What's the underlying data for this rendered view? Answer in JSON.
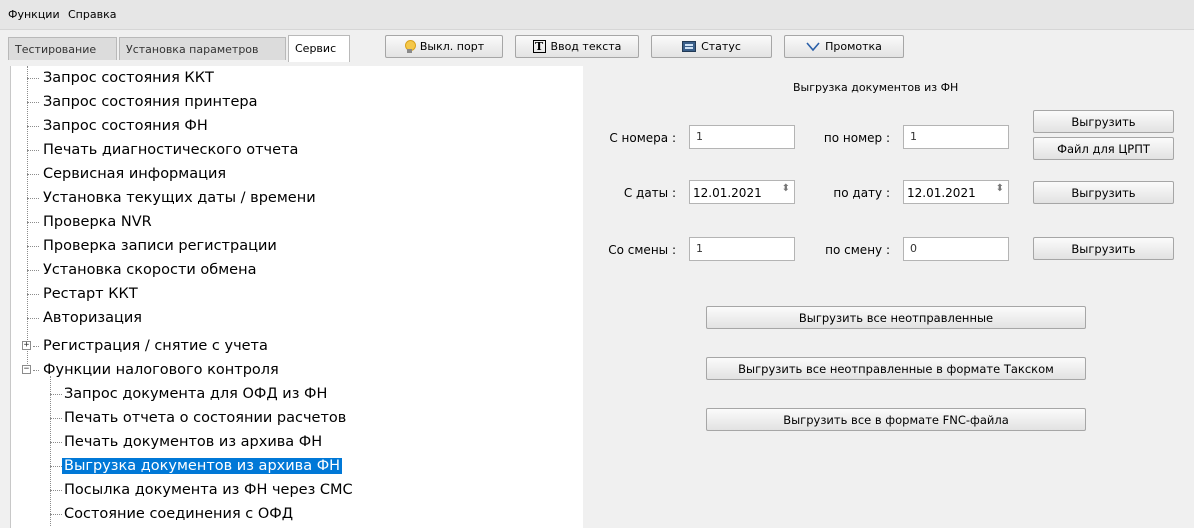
{
  "menu": {
    "items": [
      "Функции",
      "Справка"
    ]
  },
  "tabs": [
    {
      "label": "Тестирование"
    },
    {
      "label": "Установка параметров"
    },
    {
      "label": "Сервис",
      "active": true
    }
  ],
  "toolbar": {
    "port_off": "Выкл. порт",
    "text_input": "Ввод текста",
    "status": "Статус",
    "feed": "Промотка"
  },
  "tree": {
    "items": [
      "Запрос состояния ККТ",
      "Запрос состояния принтера",
      "Запрос состояния ФН",
      "Печать диагностического отчета",
      "Сервисная информация",
      "Установка текущих даты / времени",
      "Проверка NVR",
      "Проверка записи регистрации",
      "Установка скорости обмена",
      "Рестарт ККТ",
      "Авторизация",
      "Регистрация / снятие с учета",
      "Функции налогового контроля"
    ],
    "children": [
      "Запрос документа для ОФД из ФН",
      "Печать отчета о состоянии расчетов",
      "Печать документов из архива ФН",
      "Выгрузка документов из архива ФН",
      "Посылка документа из ФН через СМС",
      "Состояние соединения с ОФД"
    ],
    "selected": "Выгрузка документов из архива ФН"
  },
  "panel": {
    "title": "Выгрузка документов из ФН",
    "by_number": {
      "from_label": "С номера :",
      "from_value": "1",
      "to_label": "по номер :",
      "to_value": "1",
      "export_button": "Выгрузить",
      "file_button": "Файл для ЦРПТ"
    },
    "by_date": {
      "from_label": "С даты :",
      "from_value": "12.01.2021",
      "to_label": "по дату :",
      "to_value": "12.01.2021",
      "export_button": "Выгрузить"
    },
    "by_shift": {
      "from_label": "Со смены :",
      "from_value": "1",
      "to_label": "по смену :",
      "to_value": "0",
      "export_button": "Выгрузить"
    },
    "export_unsent": "Выгрузить все неотправленные",
    "export_unsent_taxcom": "Выгрузить все неотправленные в формате Такском",
    "export_fnc": "Выгрузить все в формате FNC-файла"
  }
}
